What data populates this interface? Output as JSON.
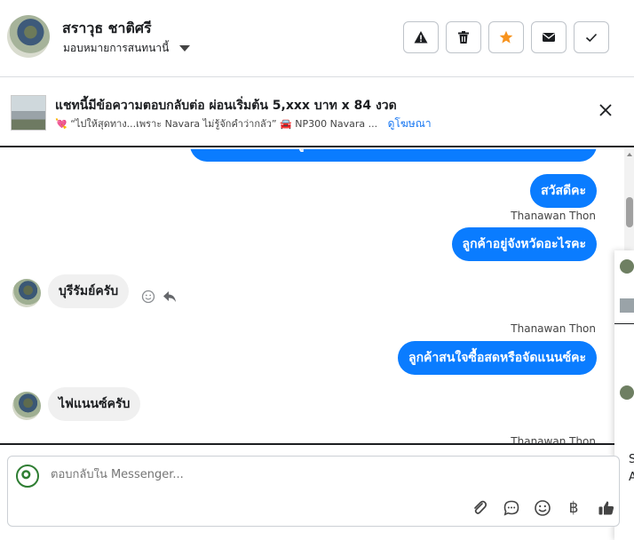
{
  "header": {
    "name": "สราวุธ ชาติศรี",
    "assign_label": "มอบหมายการสนทนานี้",
    "actions": [
      "warning-icon",
      "trash-icon",
      "star-icon",
      "mail-icon",
      "check-icon"
    ],
    "star_color": "#f7931e"
  },
  "ad": {
    "title": "แชทนี้มีข้อความตอบกลับต่อ ผ่อนเริ่มต้น 5,xxx บาท x 84 งวด",
    "description": "💘 “ไปให้สุดทาง...เพราะ Navara ไม่รู้จักคำว่ากลัว” 🚘 NP300 Navara ...",
    "link": "ดูโฆษณา"
  },
  "chat": {
    "accent": "#0a7cff",
    "messages": [
      {
        "dir": "out",
        "text": "ลิงค์ได้โปรดส่งข้อมูลติดต่อ"
      },
      {
        "dir": "out",
        "text": "สวัสดีคะ"
      },
      {
        "dir": "sender",
        "text": "Thanawan Thon"
      },
      {
        "dir": "out",
        "text": "ลูกค้าอยู่จังหวัดอะไรคะ"
      },
      {
        "dir": "in",
        "text": "บุรีรัมย์ครับ"
      },
      {
        "dir": "sender",
        "text": "Thanawan Thon"
      },
      {
        "dir": "out",
        "text": "ลูกค้าสนใจซื้อสดหรือจัดแนนซ์คะ"
      },
      {
        "dir": "in",
        "text": "ไฟแนนซ์ครับ"
      },
      {
        "dir": "sender",
        "text": "Thanawan Thon"
      }
    ]
  },
  "peek": {
    "text1": "S",
    "text2": "A"
  },
  "composer": {
    "placeholder": "ตอบกลับใน Messenger...",
    "currency_symbol": "฿",
    "icons": [
      "attachment-icon",
      "saved-reply-icon",
      "emoji-icon",
      "baht-icon",
      "thumbs-up-icon"
    ]
  }
}
